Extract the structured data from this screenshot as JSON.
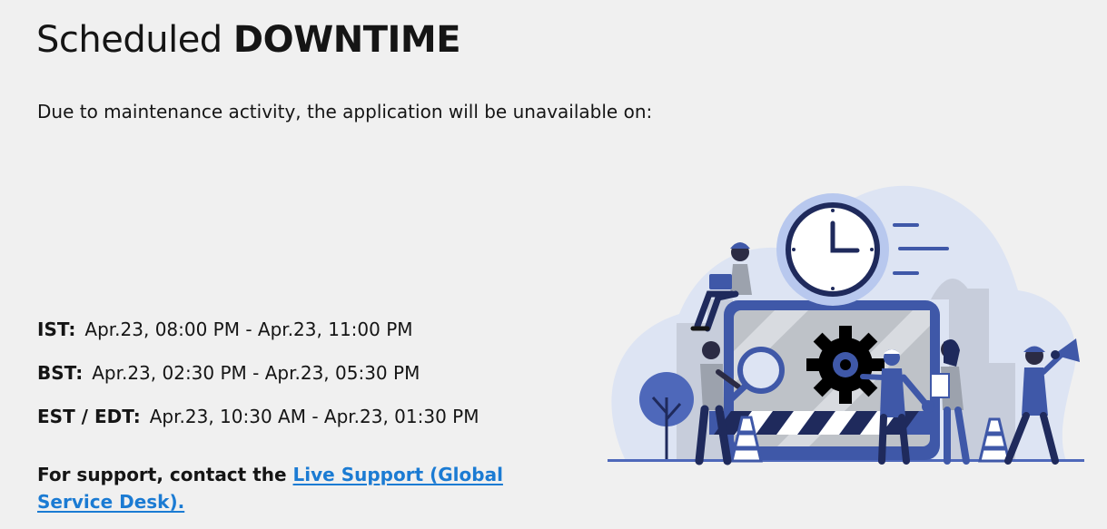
{
  "heading": {
    "prefix": "Scheduled",
    "emphasis": "DOWNTIME"
  },
  "intro": "Due to maintenance activity, the application will be unavailable on:",
  "schedule": [
    {
      "zone": "IST:",
      "window": "Apr.23, 08:00 PM - Apr.23, 11:00 PM"
    },
    {
      "zone": "BST:",
      "window": "Apr.23, 02:30 PM - Apr.23, 05:30 PM"
    },
    {
      "zone": "EST / EDT:",
      "window": "Apr.23, 10:30 AM - Apr.23, 01:30 PM"
    }
  ],
  "support": {
    "text": "For support, contact the",
    "link_label": "Live Support (Global Service Desk)."
  },
  "illustration": {
    "icons": [
      "clock-icon",
      "gear-icon",
      "magnifier-icon",
      "megaphone-icon",
      "wrench-icon",
      "traffic-cone-icon"
    ]
  },
  "colors": {
    "background": "#f0f0f0",
    "text": "#151515",
    "link": "#1b7bd3",
    "illustration_blue": "#3f58a8",
    "illustration_navy": "#1f2a5c",
    "illustration_light": "#dde4f3"
  }
}
